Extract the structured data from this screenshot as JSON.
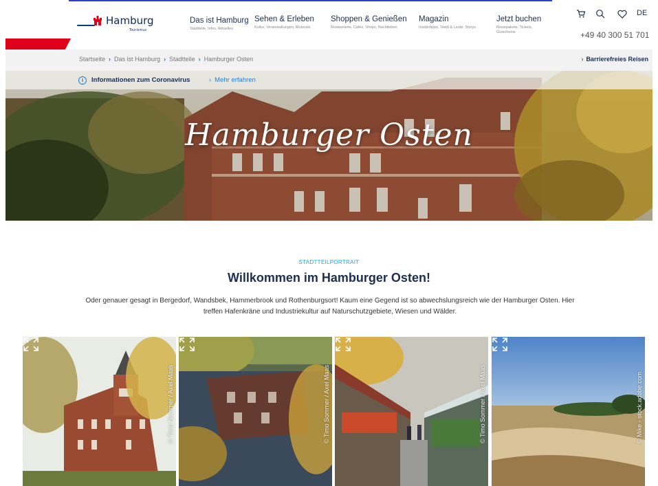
{
  "brand": {
    "logo_name": "Hamburg",
    "logo_sub": "Tourismus"
  },
  "nav": [
    {
      "title": "Das ist Hamburg",
      "sub": "Stadtteile, Infos, Aktuelles"
    },
    {
      "title": "Sehen & Erleben",
      "sub": "Kultur, Veranstaltungen, Musicals"
    },
    {
      "title": "Shoppen & Genießen",
      "sub": "Restaurants, Cafés, Shops, Nachtleben"
    },
    {
      "title": "Magazin",
      "sub": "Insidertipps, Stadt & Leute, Storys"
    },
    {
      "title": "Jetzt buchen",
      "sub": "Reisepakete, Tickets, Gutscheine"
    }
  ],
  "utility": {
    "cart_icon": "cart-icon",
    "search_icon": "search-icon",
    "favorites_icon": "heart-icon",
    "language": "DE",
    "phone": "+49 40 300 51 701"
  },
  "breadcrumb": {
    "items": [
      "Startseite",
      "Das ist Hamburg",
      "Stadtteile",
      "Hamburger Osten"
    ],
    "accessible": "Barrierefreies Reisen"
  },
  "corona": {
    "label": "Informationen zum Coronavirus",
    "link": "Mehr erfahren"
  },
  "hero": {
    "title": "Hamburger Osten"
  },
  "intro": {
    "kicker": "STADTTEILPORTRAIT",
    "title": "Willkommen im Hamburger Osten!",
    "text": "Oder genauer gesagt in Bergedorf, Wandsbek, Hammerbrook und Rothenburgsort! Kaum eine Gegend ist so abwechslungsreich wie der Hamburger Osten. Hier treffen Hafenkräne und Industriekultur auf Naturschutzgebiete, Wiesen und Wälder."
  },
  "gallery": [
    {
      "credit": "© Timo Sommer / Axel Maas"
    },
    {
      "credit": "© Timo Sommer / Axel Maas"
    },
    {
      "credit": "© Timo Sommer / Axel Maas"
    },
    {
      "credit": "© Mike - stock.adobe.com"
    }
  ],
  "colors": {
    "brand_red": "#e1001a",
    "navy": "#1d2e52",
    "link_blue": "#2a7fd6"
  }
}
